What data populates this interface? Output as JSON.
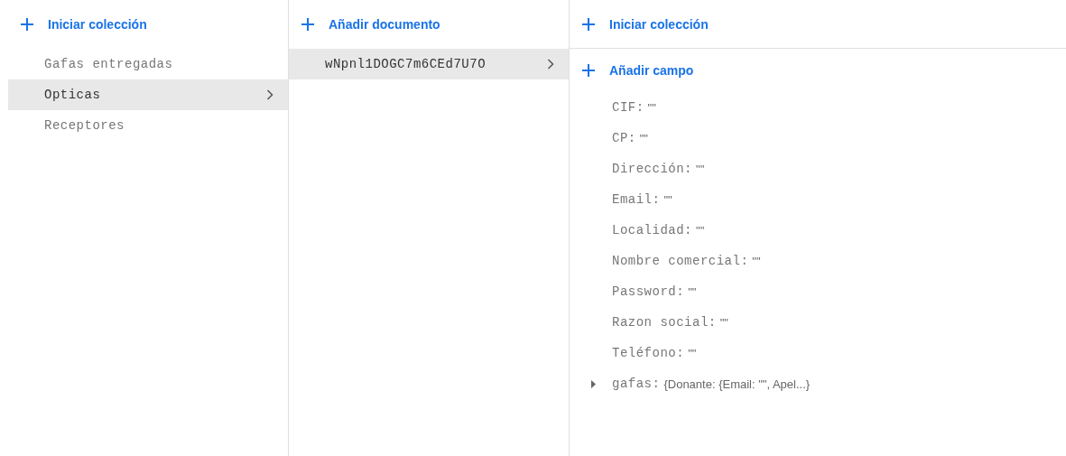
{
  "columns": [
    {
      "action": "Iniciar colección",
      "items": [
        {
          "label": "Gafas entregadas",
          "selected": false
        },
        {
          "label": "Opticas",
          "selected": true
        },
        {
          "label": "Receptores",
          "selected": false
        }
      ]
    },
    {
      "action": "Añadir documento",
      "items": [
        {
          "label": "wNpnl1DOGC7m6CEd7U7O",
          "selected": true
        }
      ]
    }
  ],
  "document": {
    "collection_action": "Iniciar colección",
    "field_action": "Añadir campo",
    "fields": [
      {
        "name": "CIF:",
        "value": "\"\""
      },
      {
        "name": "CP:",
        "value": "\"\""
      },
      {
        "name": "Dirección:",
        "value": "\"\""
      },
      {
        "name": "Email:",
        "value": "\"\""
      },
      {
        "name": "Localidad:",
        "value": "\"\""
      },
      {
        "name": "Nombre comercial:",
        "value": "\"\""
      },
      {
        "name": "Password:",
        "value": "\"\""
      },
      {
        "name": "Razon social:",
        "value": "\"\""
      },
      {
        "name": "Teléfono:",
        "value": "\"\""
      },
      {
        "name": "gafas:",
        "value": "{Donante: {Email: \"\", Apel...}",
        "expanded": false
      }
    ]
  }
}
